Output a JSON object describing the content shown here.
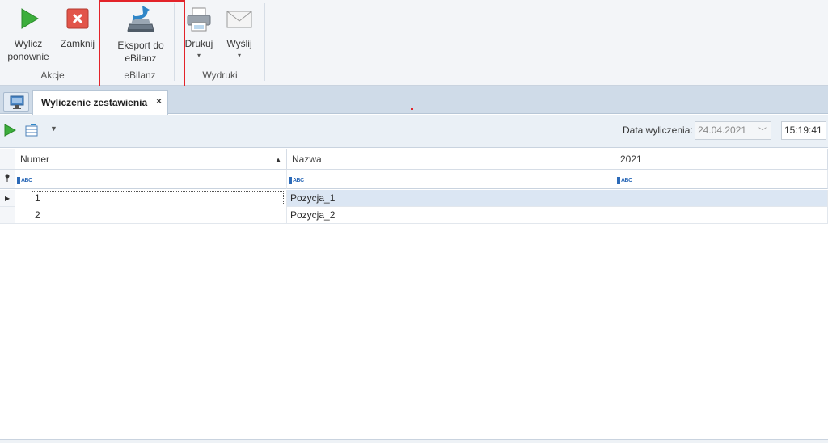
{
  "ribbon": {
    "buttons": {
      "recalc": "Wylicz ponownie",
      "close": "Zamknij",
      "export": "Eksport do eBilanz",
      "print": "Drukuj",
      "send": "Wyślij"
    },
    "groups": {
      "actions": "Akcje",
      "ebilanz": "eBilanz",
      "prints": "Wydruki"
    }
  },
  "tabs": {
    "active": "Wyliczenie zestawienia",
    "close_symbol": "×"
  },
  "toolbar": {
    "date_label": "Data wyliczenia:",
    "date_value": "24.04.2021",
    "time_value": "15:19:41"
  },
  "grid": {
    "columns": [
      "Numer",
      "Nazwa",
      "2021"
    ],
    "rows": [
      {
        "numer": "1",
        "nazwa": "Pozycja_1",
        "value": ""
      },
      {
        "numer": "2",
        "nazwa": "Pozycja_2",
        "value": ""
      }
    ]
  },
  "colors": {
    "highlight_box": "#e3232a",
    "selected_row": "#dbe6f3",
    "tab_strip": "#cfdbe8"
  }
}
